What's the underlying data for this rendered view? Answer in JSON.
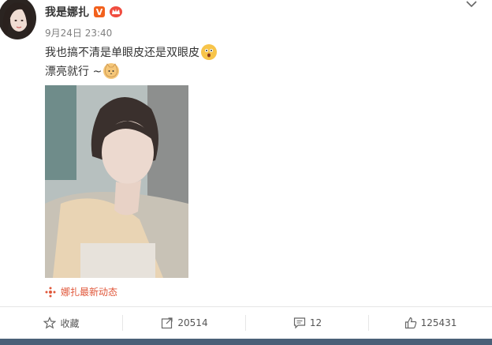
{
  "post": {
    "user_name": "我是娜扎",
    "verified_badge": "V",
    "timestamp": "9月24日 23:40",
    "text_line1": "我也搞不清是单眼皮还是双眼皮",
    "text_line2": "漂亮就行 ~",
    "source_link": "娜扎最新动态"
  },
  "actions": {
    "favorite": "收藏",
    "share": "20514",
    "comment": "12",
    "like": "125431"
  },
  "icons": {
    "avatar": "profile-photo",
    "member": "member-crown-icon",
    "more": "chevron-down-icon",
    "emoji1": "surprised-face-emoji",
    "emoji2": "cat-face-emoji",
    "source": "weibo-logo-icon",
    "favorite": "star-icon",
    "share": "share-icon",
    "comment": "comment-icon",
    "like": "thumbs-up-icon"
  },
  "colors": {
    "accent_orange": "#f2611d",
    "source_link": "#e0573a",
    "timestamp": "#808080",
    "footer_strip": "#4a6078"
  }
}
